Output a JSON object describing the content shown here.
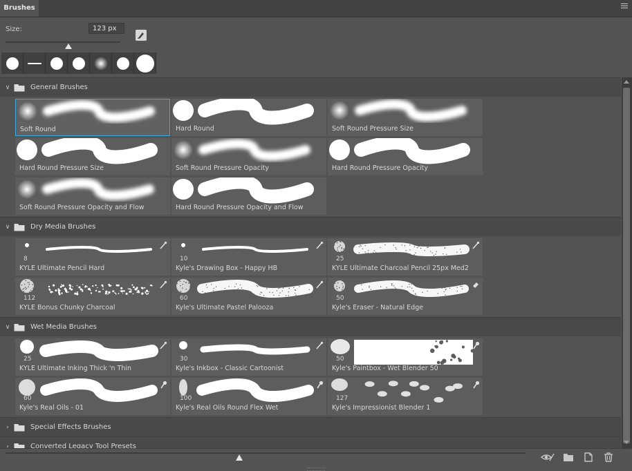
{
  "panel": {
    "tab_label": "Brushes",
    "size_label": "Size:",
    "size_value": "123 px",
    "size_slider_value": 0.55,
    "thumb_zoom_value": 0.45
  },
  "recent_brushes": [
    {
      "shape": "hard-dot"
    },
    {
      "shape": "flat-line"
    },
    {
      "shape": "hard-dot"
    },
    {
      "shape": "hard-dot"
    },
    {
      "shape": "soft-dot"
    },
    {
      "shape": "hard-dot"
    },
    {
      "shape": "hard-large"
    }
  ],
  "groups": [
    {
      "name": "General Brushes",
      "expanded": true,
      "brushes": [
        {
          "name": "Soft Round",
          "style": "soft",
          "selected": true
        },
        {
          "name": "Hard Round",
          "style": "hard"
        },
        {
          "name": "Soft Round Pressure Size",
          "style": "soft"
        },
        {
          "name": "Hard Round Pressure Size",
          "style": "hard"
        },
        {
          "name": "Soft Round Pressure Opacity",
          "style": "soft"
        },
        {
          "name": "Hard Round Pressure Opacity",
          "style": "hard"
        },
        {
          "name": "Soft Round Pressure Opacity and Flow",
          "style": "soft"
        },
        {
          "name": "Hard Round Pressure Opacity and Flow",
          "style": "hard"
        }
      ]
    },
    {
      "name": "Dry Media Brushes",
      "expanded": true,
      "brushes": [
        {
          "name": "KYLE Ultimate Pencil Hard",
          "size": "8",
          "style": "pencil",
          "tool": "brush-tool-icon"
        },
        {
          "name": "Kyle's Drawing Box - Happy HB",
          "size": "10",
          "style": "pencil",
          "tool": "brush-tool-icon"
        },
        {
          "name": "KYLE Ultimate Charcoal Pencil 25px Med2",
          "size": "25",
          "style": "charcoal",
          "tool": "brush-tool-icon"
        },
        {
          "name": "KYLE Bonus Chunky Charcoal",
          "size": "112",
          "style": "chunky",
          "tool": "brush-tool-icon"
        },
        {
          "name": "Kyle's Ultimate Pastel Palooza",
          "size": "60",
          "style": "pastel",
          "tool": "brush-tool-icon"
        },
        {
          "name": "Kyle's Eraser - Natural Edge",
          "size": "50",
          "style": "eraser",
          "tool": "eraser-tool-icon"
        }
      ]
    },
    {
      "name": "Wet Media Brushes",
      "expanded": true,
      "brushes": [
        {
          "name": "KYLE Ultimate Inking Thick 'n Thin",
          "size": "25",
          "style": "ink",
          "tool": "brush-tool-icon"
        },
        {
          "name": "Kyle's Inkbox - Classic Cartoonist",
          "size": "30",
          "style": "inkthin",
          "tool": "brush-tool-icon"
        },
        {
          "name": "Kyle's Paintbox - Wet Blender 50",
          "size": "50",
          "style": "blender",
          "tool": "mixer-brush-icon"
        },
        {
          "name": "Kyle's Real Oils - 01",
          "size": "60",
          "style": "oil",
          "tool": "mixer-brush-icon"
        },
        {
          "name": "Kyle's Real Oils Round Flex Wet",
          "size": "100",
          "style": "oilflex",
          "tool": "mixer-brush-icon"
        },
        {
          "name": "Kyle's Impressionist Blender 1",
          "size": "127",
          "style": "impressionist",
          "tool": "mixer-brush-icon"
        }
      ]
    },
    {
      "name": "Special Effects Brushes",
      "expanded": false,
      "brushes": []
    },
    {
      "name": "Converted Legacy Tool Presets",
      "expanded": false,
      "brushes": []
    }
  ],
  "footer": {
    "icons": [
      "eye-toggle-icon",
      "new-group-folder-icon",
      "new-brush-icon",
      "delete-trash-icon"
    ]
  },
  "colors": {
    "panel_bg": "#535353",
    "selection_outline": "#3ea8e0",
    "cell_bg": "#5d5d5d"
  }
}
